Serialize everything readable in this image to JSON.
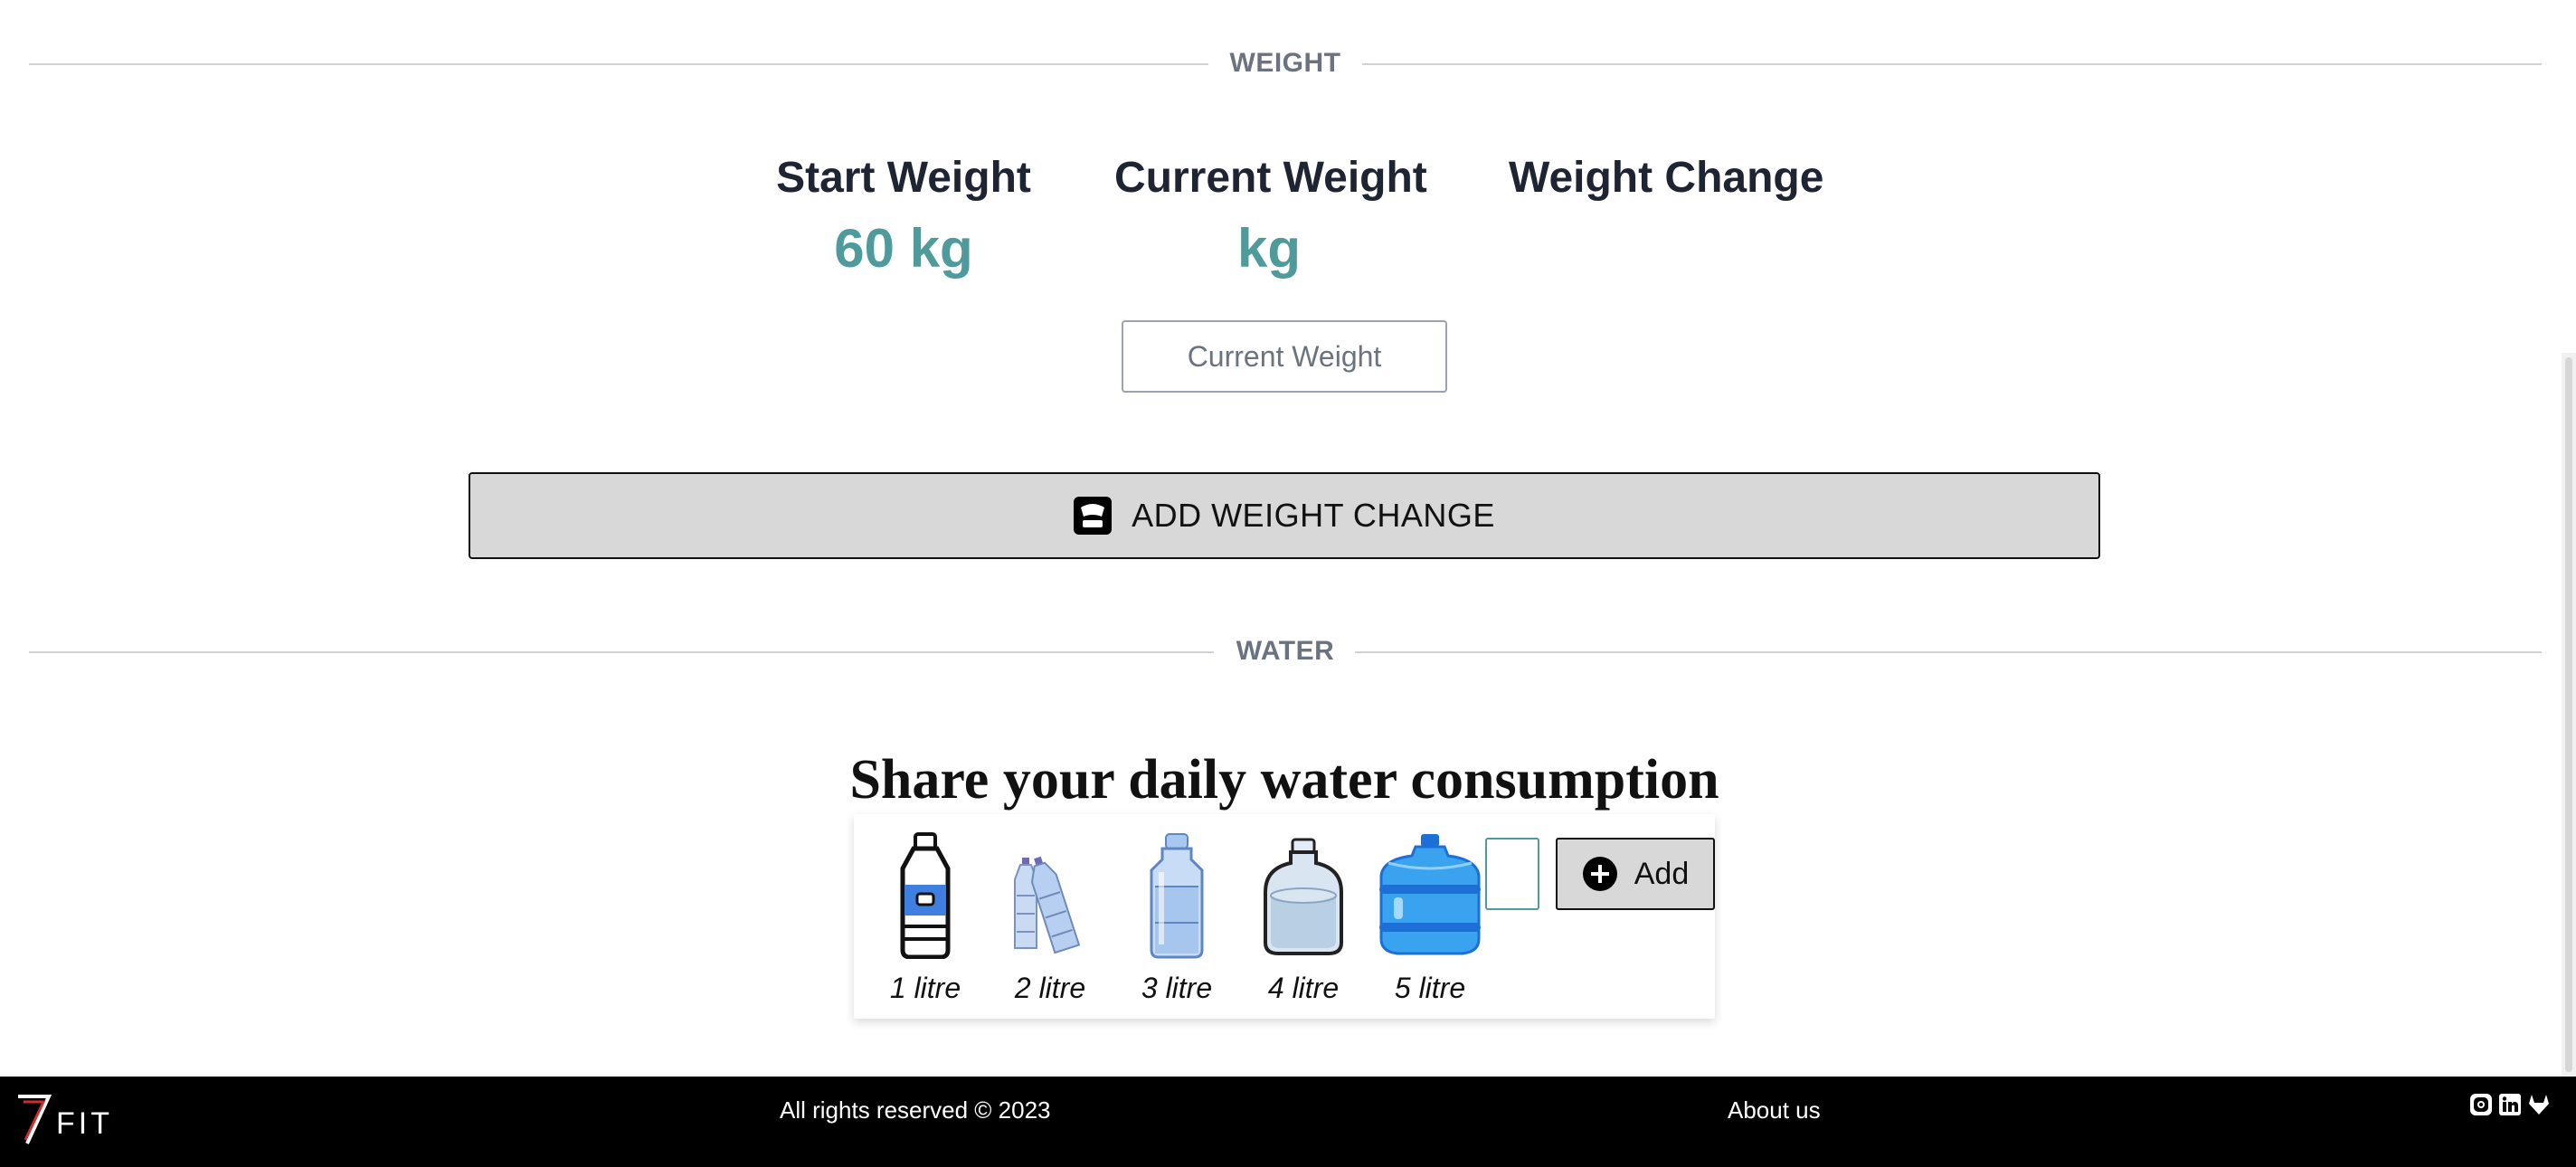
{
  "weight_section": {
    "divider_label": "WEIGHT",
    "start_weight_title": "Start Weight",
    "start_weight_value": "60 kg",
    "current_weight_title": "Current Weight",
    "current_weight_value": "kg",
    "weight_change_title": "Weight Change",
    "weight_change_value": "",
    "current_weight_input_placeholder": "Current Weight",
    "add_button_label": "ADD WEIGHT CHANGE",
    "add_button_icon": "scale-icon"
  },
  "water_section": {
    "divider_label": "WATER",
    "heading": "Share your daily water consumption",
    "options": [
      {
        "label": "1 litre",
        "icon": "bottle-1l-icon"
      },
      {
        "label": "2 litre",
        "icon": "bottles-2l-icon"
      },
      {
        "label": "3 litre",
        "icon": "bottle-3l-icon"
      },
      {
        "label": "4 litre",
        "icon": "jug-4l-icon"
      },
      {
        "label": "5 litre",
        "icon": "water-cooler-5l-icon"
      }
    ],
    "amount_input_value": "",
    "add_button_label": "Add",
    "add_button_icon": "plus-circle-icon"
  },
  "footer": {
    "logo_text": "FIT",
    "copyright": "All rights reserved © 2023",
    "about_link": "About us",
    "social_icons": [
      "instagram-icon",
      "linkedin-icon",
      "gitlab-icon"
    ]
  },
  "colors": {
    "accent": "#4f9a9a",
    "footer_bg": "#000000",
    "button_bg": "#d8d8d8",
    "divider_line": "#cfd2d6",
    "logo_accent": "#d12b2b"
  }
}
